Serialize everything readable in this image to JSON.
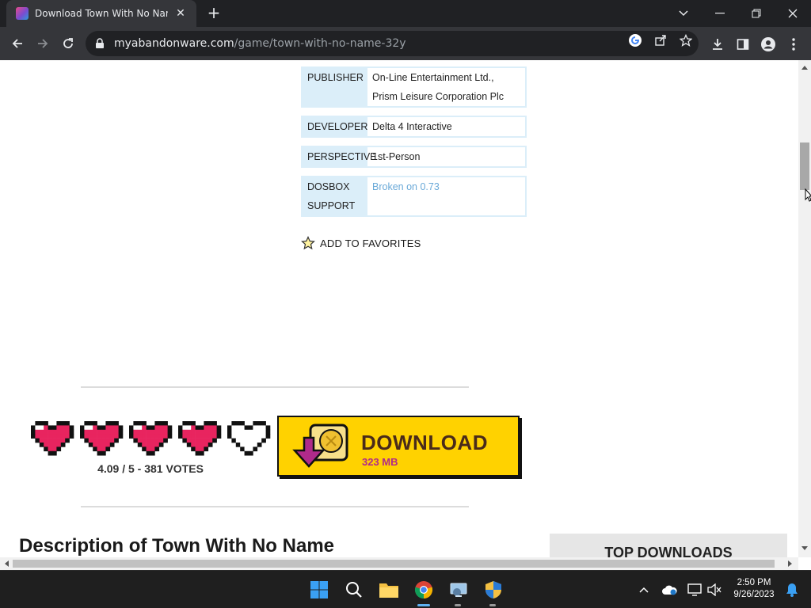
{
  "browser": {
    "tab_title": "Download Town With No Name",
    "url_host": "myabandonware.com",
    "url_path": "/game/town-with-no-name-32y"
  },
  "info": {
    "publisher_label": "PUBLISHER",
    "publisher_line1": "On-Line Entertainment Ltd.,",
    "publisher_line2": "Prism Leisure Corporation Plc",
    "developer_label": "DEVELOPER",
    "developer_value": "Delta 4 Interactive",
    "perspective_label": "PERSPECTIVE",
    "perspective_value": "1st-Person",
    "dosbox_label_1": "DOSBOX",
    "dosbox_label_2": "SUPPORT",
    "dosbox_value": "Broken on 0.73"
  },
  "favorites_label": "ADD TO FAVORITES",
  "rating": {
    "score_text": "4.09 / 5 - 381 VOTES",
    "filled_hearts": 4,
    "total_hearts": 5
  },
  "download": {
    "label": "DOWNLOAD",
    "size": "323 MB"
  },
  "description_heading": "Description of Town With No Name",
  "sidebar_heading": "TOP DOWNLOADS",
  "taskbar": {
    "time": "2:50 PM",
    "date": "9/26/2023"
  },
  "colors": {
    "heart_fill": "#e8245f",
    "download_bg": "#ffd200",
    "info_label_bg": "#dbeef9",
    "link": "#6aa9d8"
  }
}
